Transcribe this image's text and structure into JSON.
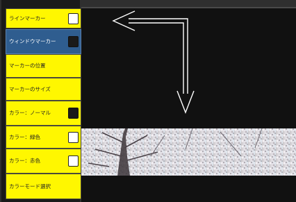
{
  "menu": {
    "items": [
      {
        "label": "ラインマーカー",
        "swatch": "white",
        "selected": false
      },
      {
        "label": "ウィンドウマーカー",
        "swatch": "black",
        "selected": true
      },
      {
        "label": "マーカーの位置",
        "swatch": "none",
        "selected": false
      },
      {
        "label": "マーカーのサイズ",
        "swatch": "none",
        "selected": false
      },
      {
        "label": "カラー：ノーマル",
        "swatch": "black",
        "selected": false
      },
      {
        "label": "カラー：緑色",
        "swatch": "white",
        "selected": false
      },
      {
        "label": "カラー：赤色",
        "swatch": "white",
        "selected": false
      },
      {
        "label": "カラーモード選択",
        "swatch": "none",
        "selected": false
      }
    ]
  },
  "colors": {
    "menu_bg": "#fff700",
    "menu_selected_bg": "#2f5d8f",
    "viewer_bg": "#111111",
    "arrow": "#ffffff"
  },
  "viewer": {
    "image_subject": "cherry blossom tree branches"
  }
}
